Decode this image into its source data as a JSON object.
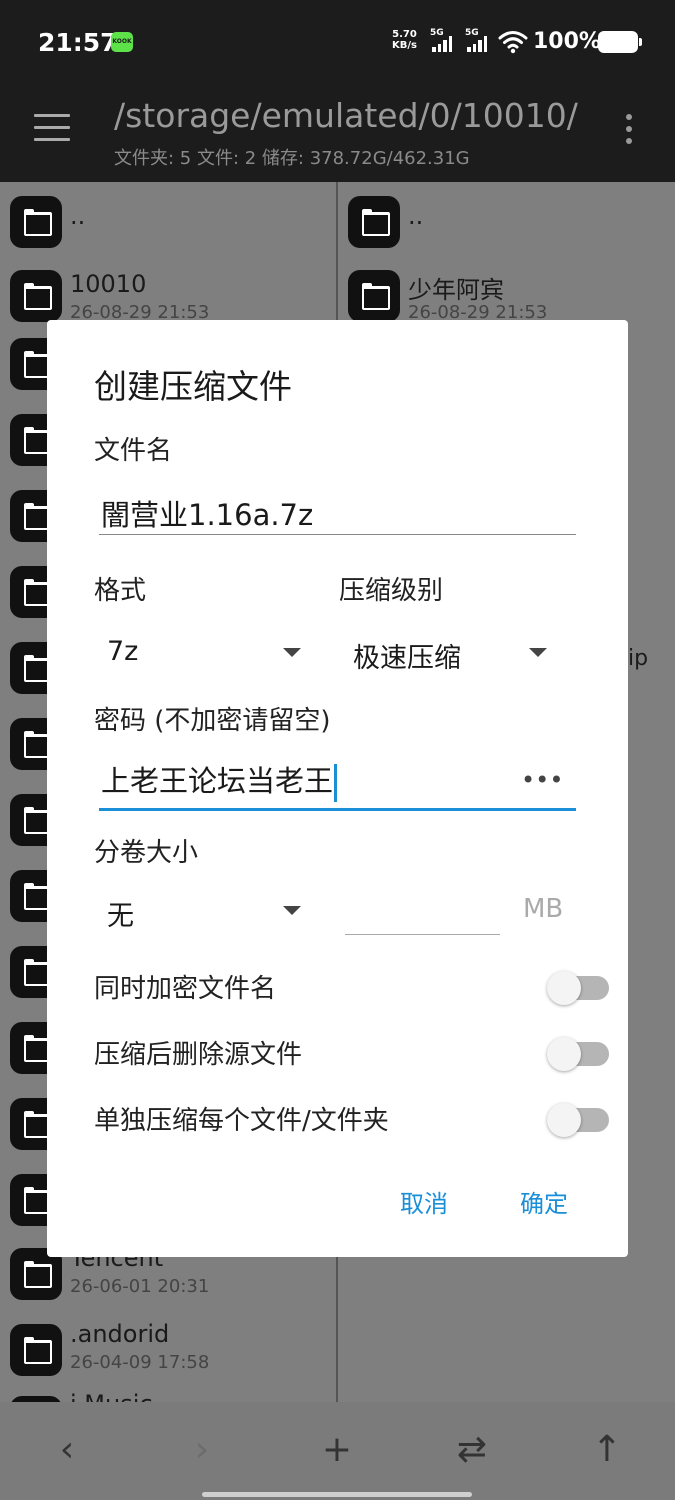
{
  "status_bar": {
    "time": "21:57",
    "app_badge": "KOOK",
    "speed_value": "5.70",
    "speed_unit": "KB/s",
    "sim1": "5G",
    "sim2": "5G",
    "battery": "100%"
  },
  "toolbar": {
    "path": "/storage/emulated/0/10010/",
    "info": "文件夹: 5  文件: 2  储存: 378.72G/462.31G"
  },
  "left_pane": {
    "rows": [
      {
        "name": "..",
        "date": ""
      },
      {
        "name": "10010",
        "date": "26-08-29 21:53"
      },
      {
        "name": "Tencent",
        "date": "26-06-01 20:31"
      },
      {
        "name": ".andorid",
        "date": "26-04-09 17:58"
      },
      {
        "name": "i.Music",
        "date": ""
      }
    ]
  },
  "right_pane": {
    "rows": [
      {
        "name": "..",
        "date": ""
      },
      {
        "name": "少年阿宾",
        "date": "26-08-29 21:53"
      }
    ],
    "partial_text": "ip"
  },
  "dialog": {
    "title": "创建压缩文件",
    "filename_label": "文件名",
    "filename_value": "闇营业1.16a.7z",
    "format_label": "格式",
    "format_value": "7z",
    "level_label": "压缩级别",
    "level_value": "极速压缩",
    "password_label": "密码 (不加密请留空)",
    "password_value": "上老王论坛当老王",
    "password_toggle": "•••",
    "volume_label": "分卷大小",
    "volume_value": "无",
    "volume_size_value": "",
    "volume_unit": "MB",
    "toggles": [
      {
        "label": "同时加密文件名",
        "on": false
      },
      {
        "label": "压缩后删除源文件",
        "on": false
      },
      {
        "label": "单独压缩每个文件/文件夹",
        "on": false
      }
    ],
    "cancel": "取消",
    "ok": "确定"
  },
  "bottom_bar": {
    "back": "‹",
    "forward": "›",
    "add": "+",
    "swap": "⇄",
    "up": "↑"
  },
  "colors": {
    "accent": "#1a8fd8",
    "pane_dim": "#7f7f7f",
    "bar_dark": "#1c1c1c"
  }
}
